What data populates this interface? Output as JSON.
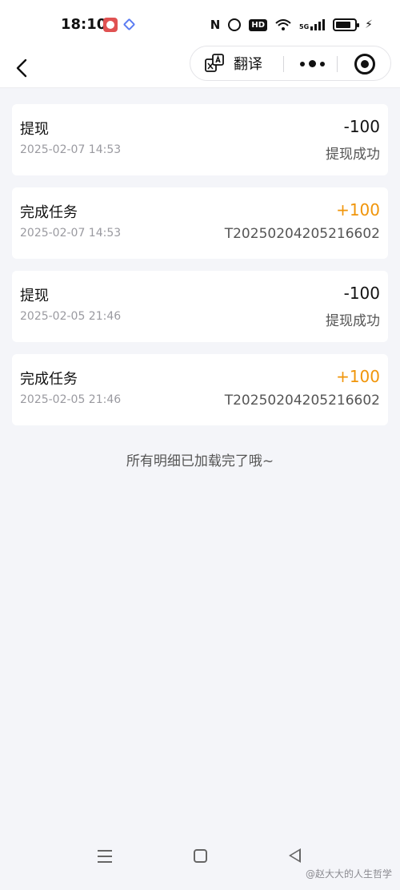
{
  "status_bar": {
    "time": "18:10",
    "icons": [
      "app-shield-icon",
      "app-diamond-icon",
      "nfc-icon",
      "alarm-icon",
      "hd-icon",
      "wifi-icon",
      "signal-5g-icon",
      "battery-icon",
      "charging-icon"
    ],
    "nfc_text": "N",
    "hd_text": "HD",
    "signal_text": "5G"
  },
  "nav": {
    "translate_label": "翻译",
    "icons": [
      "back-icon",
      "translate-icon",
      "more-icon",
      "close-mini-program-icon"
    ]
  },
  "records": [
    {
      "title": "提现",
      "time": "2025-02-07 14:53",
      "amount": "-100",
      "status": "提现成功",
      "amount_color": "#111111"
    },
    {
      "title": "完成任务",
      "time": "2025-02-07 14:53",
      "amount": "+100",
      "status": "T20250204205216602",
      "amount_color": "#f0950a"
    },
    {
      "title": "提现",
      "time": "2025-02-05 21:46",
      "amount": "-100",
      "status": "提现成功",
      "amount_color": "#111111"
    },
    {
      "title": "完成任务",
      "time": "2025-02-05 21:46",
      "amount": "+100",
      "status": "T20250204205216602",
      "amount_color": "#f0950a"
    }
  ],
  "end_note": "所有明细已加载完了哦~",
  "system_nav": {
    "icons": [
      "menu-icon",
      "home-icon",
      "back-triangle-icon"
    ]
  },
  "watermark": "@赵大大的人生哲学",
  "colors": {
    "background": "#f4f5f9",
    "card": "#ffffff",
    "positive_amount": "#f0950a",
    "muted_text": "#9a9aa0"
  }
}
